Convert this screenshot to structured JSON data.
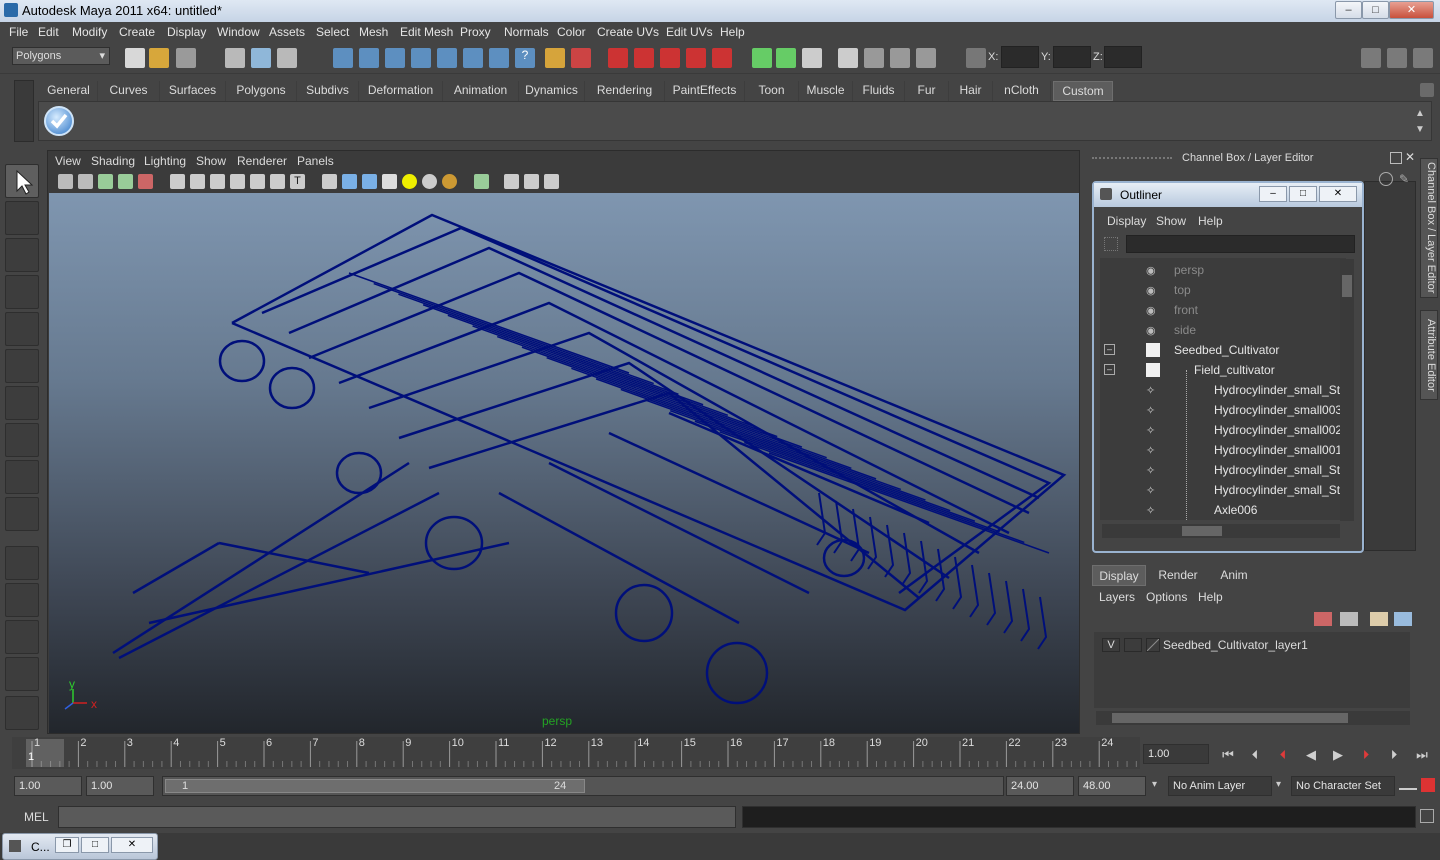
{
  "window": {
    "title": "Autodesk Maya 2011 x64: untitled*",
    "minimize": "–",
    "maximize": "□",
    "close": "✕"
  },
  "menubar": [
    "File",
    "Edit",
    "Modify",
    "Create",
    "Display",
    "Window",
    "Assets",
    "Select",
    "Mesh",
    "Edit Mesh",
    "Proxy",
    "Normals",
    "Color",
    "Create UVs",
    "Edit UVs",
    "Help"
  ],
  "status_line": {
    "mode": "Polygons",
    "x_label": "X:",
    "y_label": "Y:",
    "z_label": "Z:"
  },
  "shelf_tabs": [
    "General",
    "Curves",
    "Surfaces",
    "Polygons",
    "Subdivs",
    "Deformation",
    "Animation",
    "Dynamics",
    "Rendering",
    "PaintEffects",
    "Toon",
    "Muscle",
    "Fluids",
    "Fur",
    "Hair",
    "nCloth",
    "Custom"
  ],
  "active_shelf": "Custom",
  "viewport": {
    "menu": [
      "View",
      "Shading",
      "Lighting",
      "Show",
      "Renderer",
      "Panels"
    ],
    "camera": "persp",
    "axis_x": "x",
    "axis_y": "y"
  },
  "right_panel": {
    "header": "Channel Box / Layer Editor"
  },
  "outliner": {
    "title": "Outliner",
    "menu": [
      "Display",
      "Show",
      "Help"
    ],
    "items": [
      {
        "label": "persp",
        "type": "camera",
        "dimmed": true
      },
      {
        "label": "top",
        "type": "camera",
        "dimmed": true
      },
      {
        "label": "front",
        "type": "camera",
        "dimmed": true
      },
      {
        "label": "side",
        "type": "camera",
        "dimmed": true
      },
      {
        "label": "Seedbed_Cultivator",
        "type": "group",
        "dimmed": false
      },
      {
        "label": "Field_cultivator",
        "type": "group",
        "dimmed": false
      },
      {
        "label": "Hydrocylinder_small_Stock",
        "type": "mesh",
        "dimmed": false
      },
      {
        "label": "Hydrocylinder_small003",
        "type": "mesh",
        "dimmed": false
      },
      {
        "label": "Hydrocylinder_small002",
        "type": "mesh",
        "dimmed": false
      },
      {
        "label": "Hydrocylinder_small001",
        "type": "mesh",
        "dimmed": false
      },
      {
        "label": "Hydrocylinder_small_Stock",
        "type": "mesh",
        "dimmed": false
      },
      {
        "label": "Hydrocylinder_small_Stock",
        "type": "mesh",
        "dimmed": false
      },
      {
        "label": "Axle006",
        "type": "mesh",
        "dimmed": false
      }
    ]
  },
  "layer_editor": {
    "tabs": [
      "Display",
      "Render",
      "Anim"
    ],
    "active_tab": "Display",
    "menu": [
      "Layers",
      "Options",
      "Help"
    ],
    "layer": {
      "visible": "V",
      "name": "Seedbed_Cultivator_layer1"
    }
  },
  "vertical_tabs": [
    "Channel Box / Layer Editor",
    "Attribute Editor"
  ],
  "timeline": {
    "ticks": [
      "1",
      "2",
      "3",
      "4",
      "5",
      "6",
      "7",
      "8",
      "9",
      "10",
      "11",
      "12",
      "13",
      "14",
      "15",
      "16",
      "17",
      "18",
      "19",
      "20",
      "21",
      "22",
      "23",
      "24"
    ],
    "current_frame_marker": "1",
    "current_time": "1.00"
  },
  "range": {
    "start": "1.00",
    "playback_start": "1.00",
    "slider_start": "1",
    "slider_end": "24",
    "playback_end": "24.00",
    "end": "48.00",
    "anim_layer": "No Anim Layer",
    "character_set": "No Character Set"
  },
  "command_line": {
    "label": "MEL"
  },
  "taskbar": {
    "item": "C..."
  },
  "colors": {
    "wire": "#000f7a",
    "accent": "#9ab3d0",
    "active_tab": "#5d5d5d"
  }
}
